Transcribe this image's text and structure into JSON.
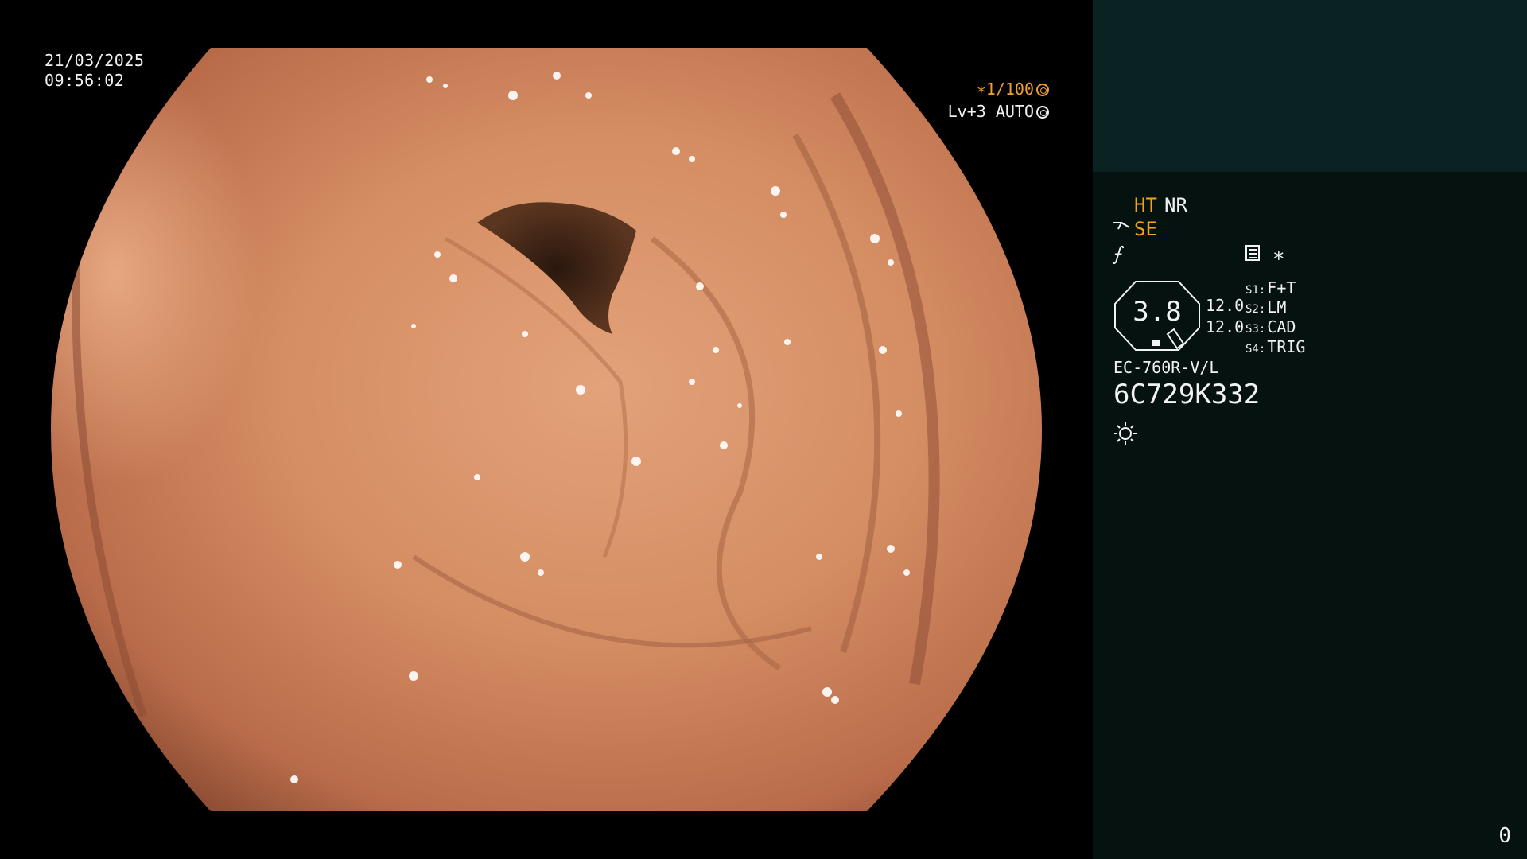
{
  "view": {
    "date": "21/03/2025",
    "time": "09:56:02",
    "shutter": "∗1/100",
    "shutter_icon": "shutter-ring-icon",
    "auto_level": "Lv+3 AUTO",
    "auto_icon": "iris-ring-icon"
  },
  "panel": {
    "ht": "HT",
    "nr": "NR",
    "se": "SE",
    "se_icon": "scope-hook-icon",
    "enhance_icon": "structure-enhance-icon",
    "memo_icon": "memo-icon",
    "star": "∗",
    "zoom_value": "3.8",
    "value_a": "12.0",
    "value_b": "12.0",
    "switches": [
      {
        "key": "S1:",
        "label": "F+T"
      },
      {
        "key": "S2:",
        "label": "LM"
      },
      {
        "key": "S3:",
        "label": "CAD"
      },
      {
        "key": "S4:",
        "label": "TRIG"
      }
    ],
    "model": "EC-760R-V/L",
    "serial": "6C729K332",
    "light_icon": "light-sun-icon",
    "frame_counter": "0"
  },
  "colors": {
    "amber": "#f3a41c",
    "panel_bg": "#051210",
    "panel_top_bg": "#0b2222",
    "tissue": "#d9926a"
  }
}
